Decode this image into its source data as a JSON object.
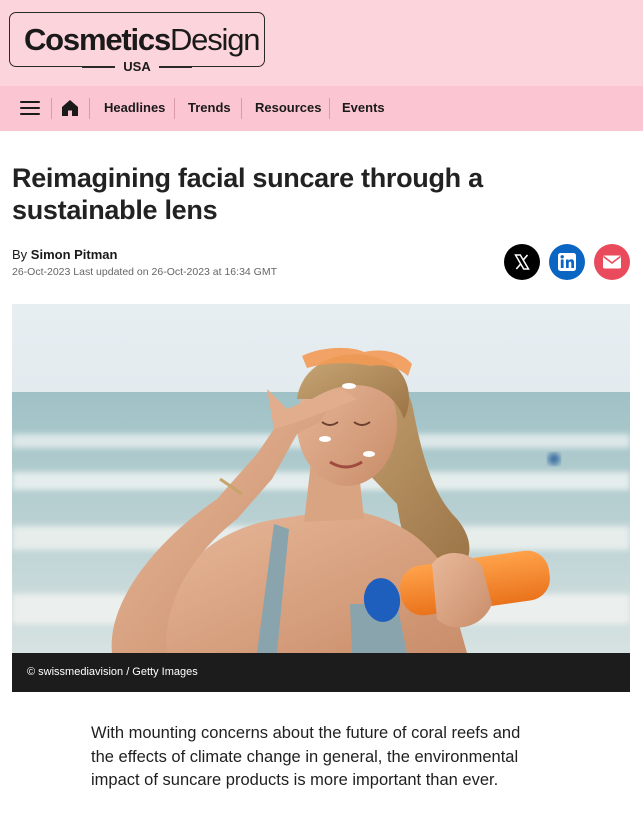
{
  "brand": {
    "name_bold": "Cosmetics",
    "name_light": "Design",
    "region": "USA"
  },
  "nav": {
    "items": [
      {
        "label": "Headlines"
      },
      {
        "label": "Trends"
      },
      {
        "label": "Resources"
      },
      {
        "label": "Events"
      }
    ]
  },
  "article": {
    "title": "Reimagining facial suncare through a sustainable lens",
    "byline_prefix": "By",
    "author": "Simon Pitman",
    "dateline": "26-Oct-2023 Last updated on 26-Oct-2023 at 16:34 GMT",
    "image_credit": "© swissmediavision / Getty Images",
    "lead": "With mounting concerns about the future of coral reefs and the effects of climate change in general, the environmental impact of suncare products is more important than ever."
  },
  "share": {
    "buttons": [
      {
        "icon": "x-icon",
        "color": "#000000"
      },
      {
        "icon": "linkedin-icon",
        "color": "#0a66c2"
      },
      {
        "icon": "email-icon",
        "color": "#ea4b5c"
      }
    ]
  },
  "colors": {
    "header_bg": "#fcd4dc",
    "nav_bg": "#fbc6d1",
    "caption_bg": "#1c1c1c"
  }
}
